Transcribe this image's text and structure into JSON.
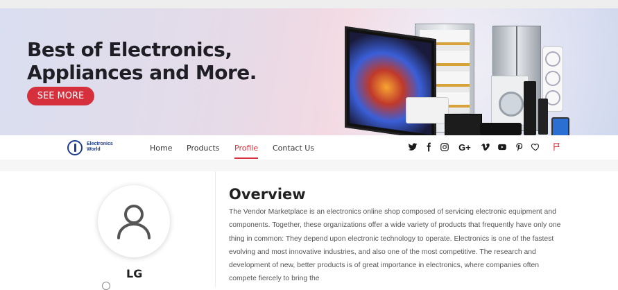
{
  "banner": {
    "headline_line1": "Best of Electronics,",
    "headline_line2": "Appliances and More.",
    "cta_label": "SEE MORE",
    "cta_color": "#d6303c"
  },
  "logo": {
    "line1": "Electronics",
    "line2": "World"
  },
  "nav": {
    "items": [
      {
        "label": "Home"
      },
      {
        "label": "Products"
      },
      {
        "label": "Profile"
      },
      {
        "label": "Contact Us"
      }
    ],
    "active": "Profile",
    "accent_color": "#d6303c"
  },
  "social": [
    "twitter-icon",
    "facebook-icon",
    "instagram-icon",
    "google-plus-icon",
    "vimeo-icon",
    "youtube-icon",
    "pinterest-icon",
    "heart-icon",
    "flag-icon"
  ],
  "vendor": {
    "name": "LG"
  },
  "overview": {
    "title": "Overview",
    "text": "The Vendor Marketplace is an electronics online shop composed of servicing  electronic equipment and components. Together, these organizations offer a wide variety of products that frequently have only one thing in common: They depend upon electronic technology to operate. Electronics is one of the fastest evolving and most innovative industries, and also one of the most competitive. The research and development of new, better products is of great importance in electronics, where companies often compete fiercely to bring the"
  }
}
